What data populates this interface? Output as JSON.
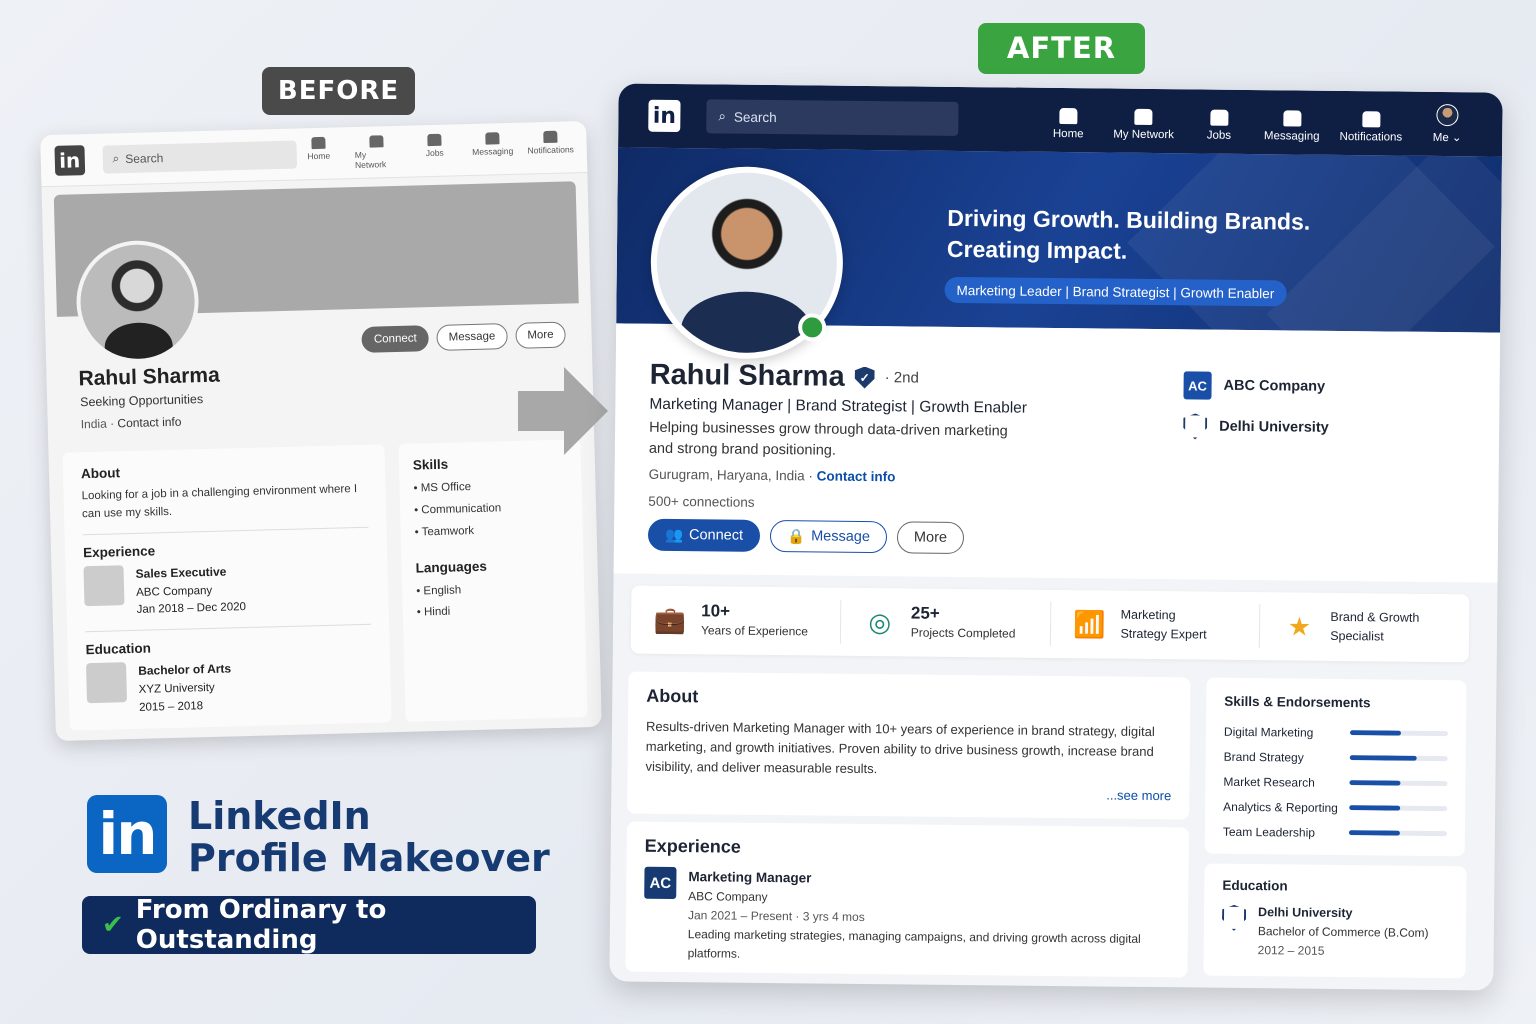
{
  "labels": {
    "before": "BEFORE",
    "after": "AFTER"
  },
  "before": {
    "logo": "in",
    "search_placeholder": "Search",
    "nav": [
      "Home",
      "My Network",
      "Jobs",
      "Messaging",
      "Notifications"
    ],
    "actions": {
      "connect": "Connect",
      "message": "Message",
      "more": "More"
    },
    "name": "Rahul Sharma",
    "subtitle": "Seeking Opportunities",
    "location": "India",
    "contact": "Contact info",
    "about": {
      "title": "About",
      "text": "Looking for a job in a challenging environment where I can use my skills."
    },
    "experience": {
      "title": "Experience",
      "role": "Sales Executive",
      "company": "ABC Company",
      "dates": "Jan 2018 – Dec 2020"
    },
    "education": {
      "title": "Education",
      "degree": "Bachelor of Arts",
      "school": "XYZ University",
      "dates": "2015 – 2018"
    },
    "skills": {
      "title": "Skills",
      "items": [
        "MS Office",
        "Communication",
        "Teamwork"
      ]
    },
    "languages": {
      "title": "Languages",
      "items": [
        "English",
        "Hindi"
      ]
    }
  },
  "branding": {
    "title_line1": "LinkedIn",
    "title_line2": "Profile Makeover",
    "logo": "in",
    "tagline": "From Ordinary to Outstanding"
  },
  "after": {
    "logo": "in",
    "search_placeholder": "Search",
    "nav": [
      "Home",
      "My Network",
      "Jobs",
      "Messaging",
      "Notifications",
      "Me"
    ],
    "banner": {
      "line1": "Driving Growth. Building Brands.",
      "line2": "Creating Impact.",
      "pill": "Marketing Leader | Brand Strategist | Growth Enabler"
    },
    "name": "Rahul Sharma",
    "degree": "· 2nd",
    "title": "Marketing Manager | Brand Strategist | Growth Enabler",
    "bio": "Helping businesses grow through data-driven marketing and strong brand positioning.",
    "location": "Gurugram, Haryana, India ·",
    "contact": "Contact info",
    "connections": "500+ connections",
    "actions": {
      "connect": "Connect",
      "message": "Message",
      "more": "More"
    },
    "affiliations": {
      "company_badge": "AC",
      "company": "ABC Company",
      "school": "Delhi University"
    },
    "stats": [
      {
        "value": "10+",
        "label": "Years of Experience",
        "icon": "briefcase-icon"
      },
      {
        "value": "25+",
        "label": "Projects Completed",
        "icon": "target-icon"
      },
      {
        "line1": "Marketing",
        "line2": "Strategy Expert",
        "icon": "chart-icon"
      },
      {
        "line1": "Brand & Growth",
        "line2": "Specialist",
        "icon": "star-icon"
      }
    ],
    "about": {
      "title": "About",
      "text": "Results-driven Marketing Manager with 10+ years of experience in brand strategy, digital marketing, and growth initiatives. Proven ability to drive business growth, increase brand visibility, and deliver measurable results.",
      "see_more": "...see more"
    },
    "experience": {
      "title": "Experience",
      "badge": "AC",
      "role": "Marketing Manager",
      "company": "ABC Company",
      "dates": "Jan 2021 – Present · 3 yrs 4 mos",
      "desc": "Leading marketing strategies, managing campaigns, and driving growth across digital platforms."
    },
    "skills": {
      "title": "Skills & Endorsements",
      "items": [
        {
          "name": "Digital Marketing",
          "level": 0.52
        },
        {
          "name": "Brand Strategy",
          "level": 0.68
        },
        {
          "name": "Market Research",
          "level": 0.52
        },
        {
          "name": "Analytics & Reporting",
          "level": 0.52
        },
        {
          "name": "Team Leadership",
          "level": 0.52
        }
      ]
    },
    "education": {
      "title": "Education",
      "school": "Delhi University",
      "degree": "Bachelor of Commerce (B.Com)",
      "dates": "2012 – 2015"
    }
  },
  "colors": {
    "brand": "#0a66c2",
    "navy": "#0f1f44",
    "accent": "#1a4fa8",
    "online": "#2f9b3f",
    "after_tag": "#3aa540"
  }
}
